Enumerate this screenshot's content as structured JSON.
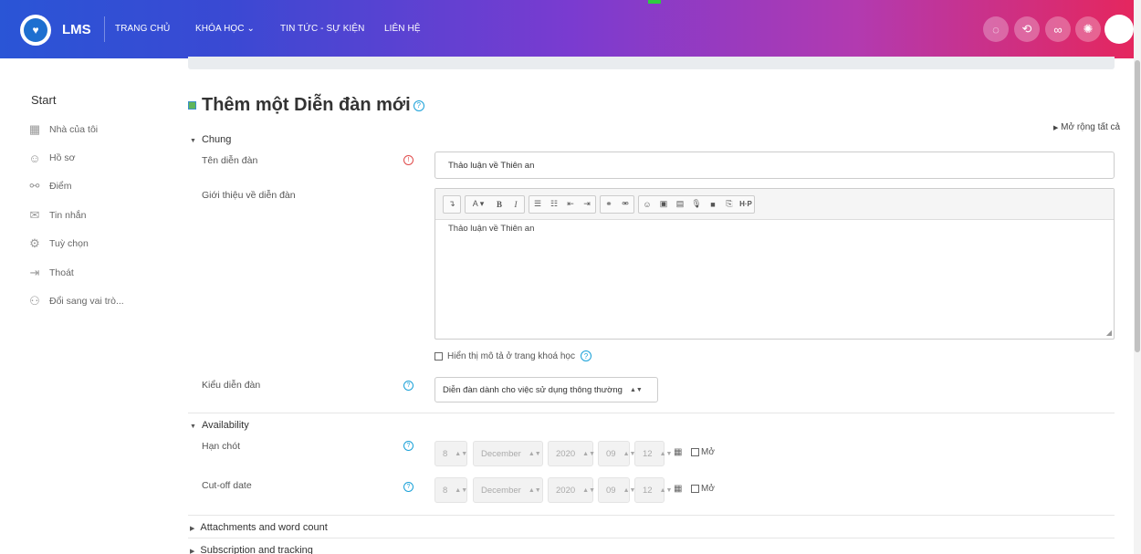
{
  "navbar": {
    "brand": "LMS",
    "items": [
      "TRANG CHỦ",
      "KHÓA HỌC ⌄",
      "TIN TỨC - SỰ KIỆN",
      "LIÊN HỆ"
    ],
    "icons": [
      "eye-slash-icon",
      "recycle-icon",
      "link-icon",
      "gear-icon"
    ]
  },
  "sidebar": {
    "start": "Start",
    "items": [
      {
        "icon": "dashboard-icon",
        "label": "Nhà của tôi"
      },
      {
        "icon": "profile-icon",
        "label": "Hồ sơ"
      },
      {
        "icon": "grades-icon",
        "label": "Điểm"
      },
      {
        "icon": "message-icon",
        "label": "Tin nhắn"
      },
      {
        "icon": "settings-icon",
        "label": "Tuỳ chọn"
      },
      {
        "icon": "logout-icon",
        "label": "Thoát"
      },
      {
        "icon": "switch-role-icon",
        "label": "Đổi sang vai trò..."
      }
    ]
  },
  "main": {
    "title": "Thêm một Diễn đàn mới",
    "expand_all": "Mở rộng tất cả",
    "general": {
      "heading": "Chung",
      "name_label": "Tên diễn đàn",
      "name_value": "Thảo luận về Thiên an",
      "intro_label": "Giới thiệu về diễn đàn",
      "intro_value": "Thảo luận về Thiên an",
      "show_desc_label": "Hiển thị mô tả ở trang khoá học",
      "type_label": "Kiểu diễn đàn",
      "type_value": "Diễn đàn dành cho việc sử dụng thông thường"
    },
    "availability": {
      "heading": "Availability",
      "due_label": "Hạn chót",
      "cutoff_label": "Cut-off date",
      "day": "8",
      "month": "December",
      "year": "2020",
      "hour": "09",
      "minute": "12",
      "enable_label": "Mở"
    },
    "collapsed_sections": [
      "Attachments and word count",
      "Subscription and tracking"
    ]
  }
}
